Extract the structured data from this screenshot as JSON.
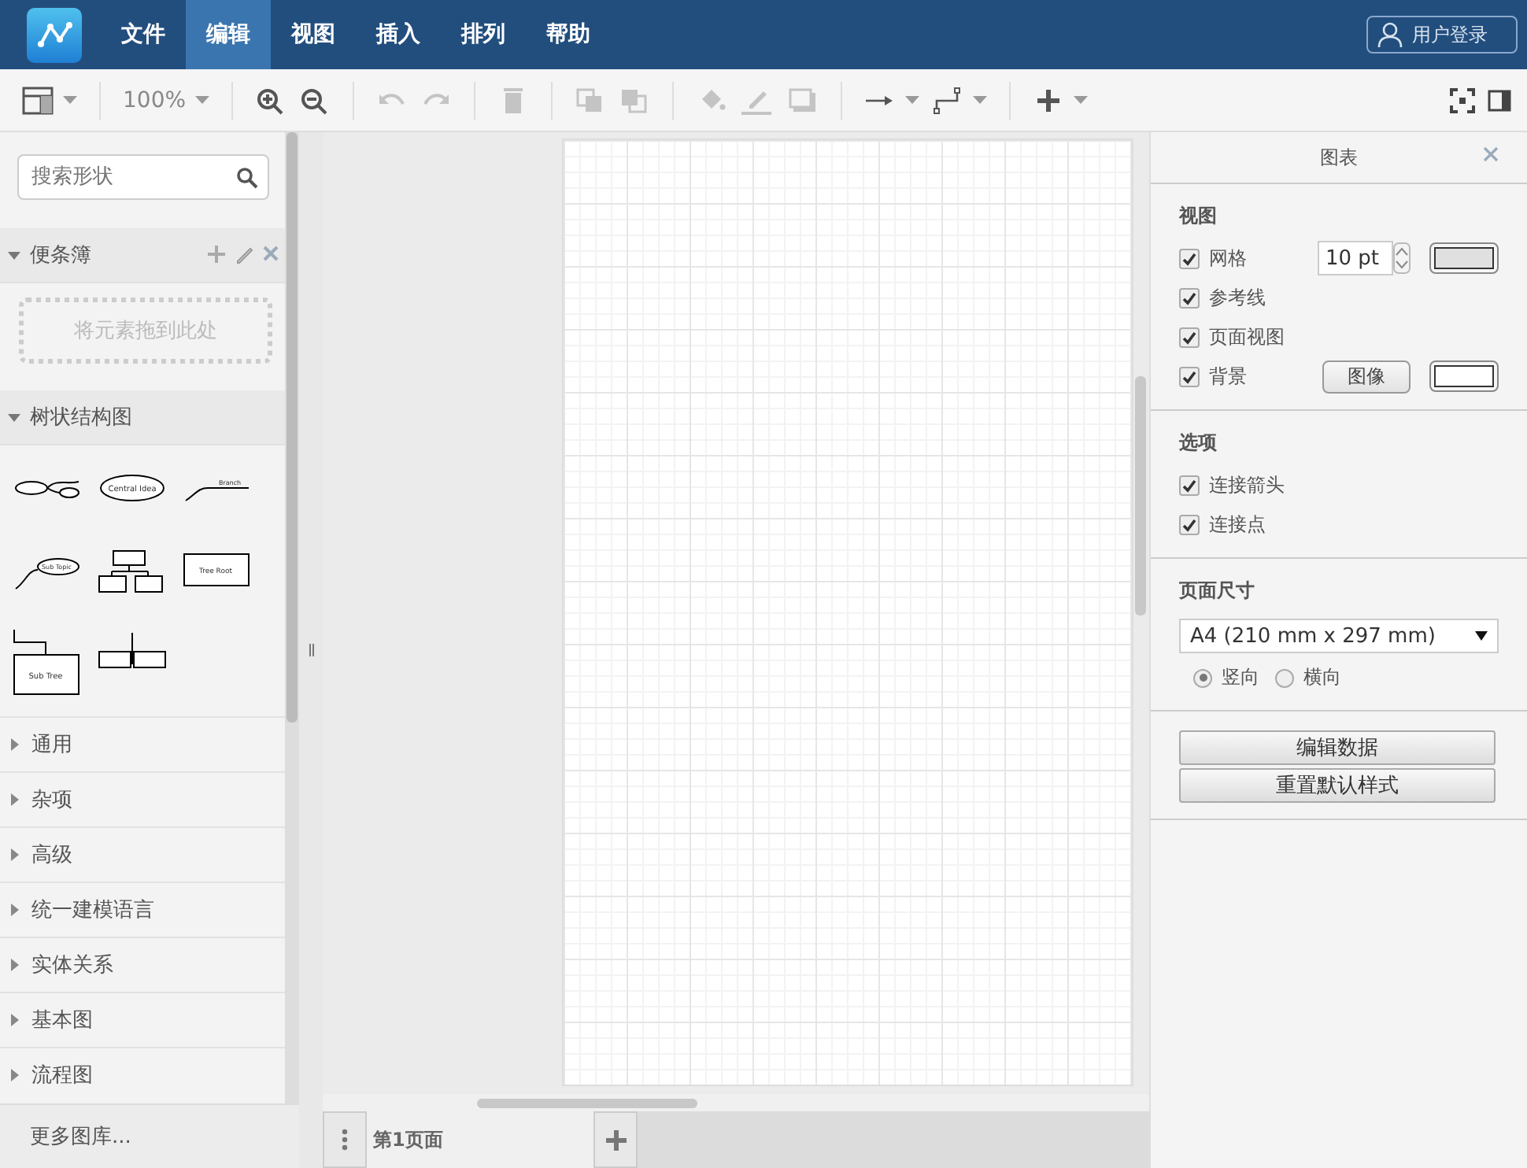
{
  "menu_bar": {
    "items": [
      {
        "label": "文件",
        "selected": false
      },
      {
        "label": "编辑",
        "selected": true
      },
      {
        "label": "视图",
        "selected": false
      },
      {
        "label": "插入",
        "selected": false
      },
      {
        "label": "排列",
        "selected": false
      },
      {
        "label": "帮助",
        "selected": false
      }
    ],
    "login_button": "用户登录"
  },
  "toolbar": {
    "zoom": "100%"
  },
  "sidebar": {
    "search": {
      "placeholder": "搜索形状"
    },
    "scratchpad": {
      "title": "便条簿",
      "expanded": true,
      "drop_hint": "将元素拖到此处"
    },
    "tree_section": {
      "title": "树状结构图",
      "expanded": true,
      "shapes": [
        {
          "kind": "mindmap"
        },
        {
          "kind": "ellipse",
          "label": "Central Idea"
        },
        {
          "kind": "branch",
          "label": "Branch"
        },
        {
          "kind": "subtopic",
          "label": "Sub Topic"
        },
        {
          "kind": "orgchart"
        },
        {
          "kind": "box",
          "label": "Tree Root"
        },
        {
          "kind": "subtree",
          "label": "Sub Tree"
        },
        {
          "kind": "container"
        }
      ]
    },
    "sections": [
      {
        "title": "通用",
        "expanded": false
      },
      {
        "title": "杂项",
        "expanded": false
      },
      {
        "title": "高级",
        "expanded": false
      },
      {
        "title": "统一建模语言",
        "expanded": false
      },
      {
        "title": "实体关系",
        "expanded": false
      },
      {
        "title": "基本图",
        "expanded": false
      },
      {
        "title": "流程图",
        "expanded": false
      }
    ],
    "more_button": "更多图库..."
  },
  "page_tabs": [
    {
      "label": "第1页面",
      "selected": true
    }
  ],
  "format_panel": {
    "title": "图表",
    "view": {
      "heading": "视图",
      "options": [
        {
          "kind": "grid",
          "label": "网格",
          "checked": true,
          "value": "10 pt"
        },
        {
          "kind": "plain",
          "label": "参考线",
          "checked": true
        },
        {
          "kind": "plain",
          "label": "页面视图",
          "checked": true
        },
        {
          "kind": "background",
          "label": "背景",
          "checked": true,
          "button": "图像"
        }
      ]
    },
    "options": {
      "heading": "选项",
      "items": [
        {
          "label": "连接箭头",
          "checked": true
        },
        {
          "label": "连接点",
          "checked": true
        }
      ]
    },
    "page_size": {
      "heading": "页面尺寸",
      "value": "A4 (210 mm x 297 mm)",
      "orientations": [
        {
          "label": "竖向",
          "selected": true
        },
        {
          "label": "横向",
          "selected": false
        }
      ]
    },
    "buttons": [
      "编辑数据",
      "重置默认样式"
    ]
  }
}
